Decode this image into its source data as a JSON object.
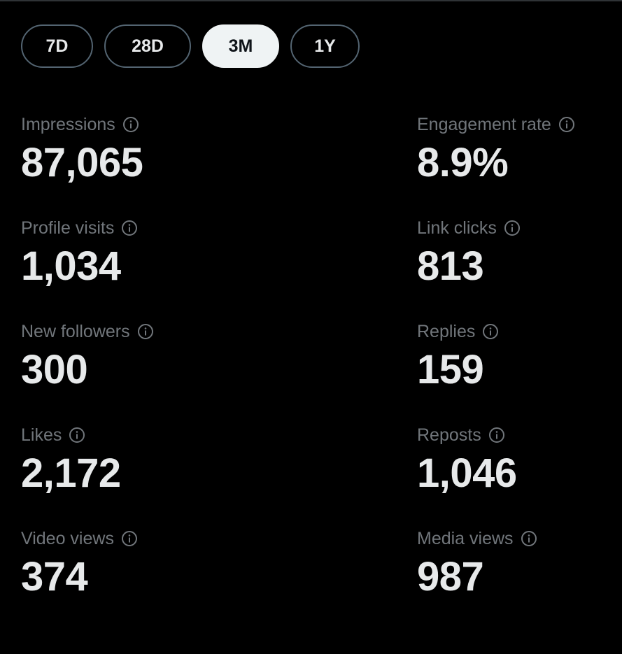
{
  "ranges": [
    {
      "label": "7D",
      "active": false
    },
    {
      "label": "28D",
      "active": false
    },
    {
      "label": "3M",
      "active": true
    },
    {
      "label": "1Y",
      "active": false
    }
  ],
  "metrics": {
    "impressions": {
      "label": "Impressions",
      "value": "87,065"
    },
    "engagement_rate": {
      "label": "Engagement rate",
      "value": "8.9%"
    },
    "profile_visits": {
      "label": "Profile visits",
      "value": "1,034"
    },
    "link_clicks": {
      "label": "Link clicks",
      "value": "813"
    },
    "new_followers": {
      "label": "New followers",
      "value": "300"
    },
    "replies": {
      "label": "Replies",
      "value": "159"
    },
    "likes": {
      "label": "Likes",
      "value": "2,172"
    },
    "reposts": {
      "label": "Reposts",
      "value": "1,046"
    },
    "video_views": {
      "label": "Video views",
      "value": "374"
    },
    "media_views": {
      "label": "Media views",
      "value": "987"
    }
  },
  "icons": {
    "info": "info-circle-icon"
  },
  "colors": {
    "background": "#000000",
    "label": "#71767b",
    "value": "#e7e9ea",
    "pill_border": "#536471",
    "pill_active_bg": "#eff3f4",
    "pill_active_text": "#0f1419"
  }
}
